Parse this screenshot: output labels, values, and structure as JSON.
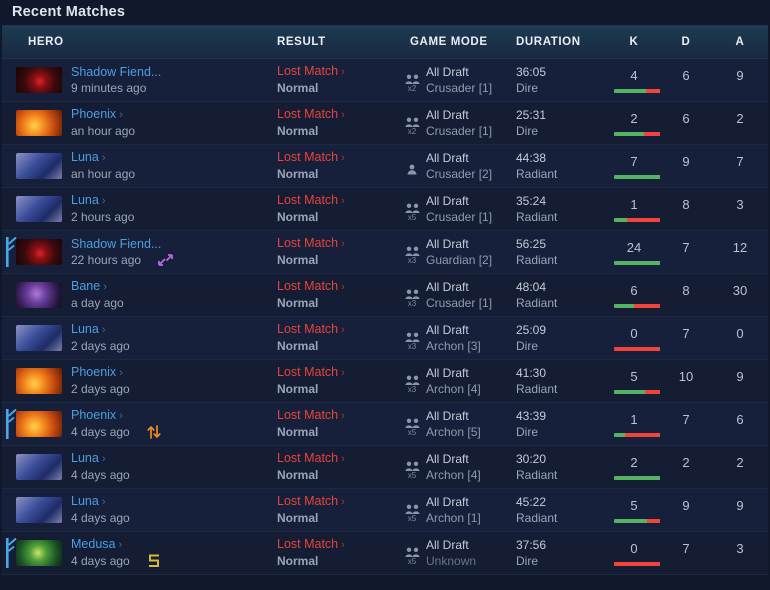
{
  "header": {
    "title": "Recent Matches"
  },
  "columns": {
    "hero": "HERO",
    "result": "RESULT",
    "game_mode": "GAME MODE",
    "duration": "DURATION",
    "k": "K",
    "d": "D",
    "a": "A"
  },
  "colors": {
    "hero_link": "#4b9fe3",
    "lost": "#e8443b",
    "kills_bar": "#55b363",
    "deaths_bar": "#f2443c",
    "assists_bar": "#8aa3b8",
    "row_flag": "#4aa8e8",
    "badge_purple": "#b968e0",
    "badge_orange": "#f08a20",
    "badge_gold": "#d9b93c"
  },
  "rows": [
    {
      "hero": "Shadow Fiend...",
      "hero_art": "p-shadowfiend",
      "chevron": false,
      "time": "9 minutes ago",
      "badge": null,
      "flag": false,
      "result": "Lost Match",
      "result_sub": "Normal",
      "mode": "All Draft",
      "rank": "Crusader [1]",
      "rank_unknown": false,
      "party": "x2",
      "party_n": 2,
      "duration": "36:05",
      "side": "Dire",
      "k": 4,
      "d": 6,
      "a": 9
    },
    {
      "hero": "Phoenix",
      "hero_art": "p-phoenix",
      "chevron": true,
      "time": "an hour ago",
      "badge": null,
      "flag": false,
      "result": "Lost Match",
      "result_sub": "Normal",
      "mode": "All Draft",
      "rank": "Crusader [1]",
      "rank_unknown": false,
      "party": "x2",
      "party_n": 2,
      "duration": "25:31",
      "side": "Dire",
      "k": 2,
      "d": 6,
      "a": 2
    },
    {
      "hero": "Luna",
      "hero_art": "p-luna",
      "chevron": true,
      "time": "an hour ago",
      "badge": null,
      "flag": false,
      "result": "Lost Match",
      "result_sub": "Normal",
      "mode": "All Draft",
      "rank": "Crusader [2]",
      "rank_unknown": false,
      "party": "",
      "party_n": 1,
      "duration": "44:38",
      "side": "Radiant",
      "k": 7,
      "d": 9,
      "a": 7
    },
    {
      "hero": "Luna",
      "hero_art": "p-luna",
      "chevron": true,
      "time": "2 hours ago",
      "badge": null,
      "flag": false,
      "result": "Lost Match",
      "result_sub": "Normal",
      "mode": "All Draft",
      "rank": "Crusader [1]",
      "rank_unknown": false,
      "party": "x5",
      "party_n": 5,
      "duration": "35:24",
      "side": "Radiant",
      "k": 1,
      "d": 8,
      "a": 3
    },
    {
      "hero": "Shadow Fiend...",
      "hero_art": "p-shadowfiend",
      "chevron": false,
      "time": "22 hours ago",
      "badge": "double-arrow-icon",
      "flag": true,
      "result": "Lost Match",
      "result_sub": "Normal",
      "mode": "All Draft",
      "rank": "Guardian [2]",
      "rank_unknown": false,
      "party": "x3",
      "party_n": 3,
      "duration": "56:25",
      "side": "Radiant",
      "k": 24,
      "d": 7,
      "a": 12
    },
    {
      "hero": "Bane",
      "hero_art": "p-bane",
      "chevron": true,
      "time": "a day ago",
      "badge": null,
      "flag": false,
      "result": "Lost Match",
      "result_sub": "Normal",
      "mode": "All Draft",
      "rank": "Crusader [1]",
      "rank_unknown": false,
      "party": "x3",
      "party_n": 3,
      "duration": "48:04",
      "side": "Radiant",
      "k": 6,
      "d": 8,
      "a": 30
    },
    {
      "hero": "Luna",
      "hero_art": "p-luna",
      "chevron": true,
      "time": "2 days ago",
      "badge": null,
      "flag": false,
      "result": "Lost Match",
      "result_sub": "Normal",
      "mode": "All Draft",
      "rank": "Archon [3]",
      "rank_unknown": false,
      "party": "x3",
      "party_n": 3,
      "duration": "25:09",
      "side": "Dire",
      "k": 0,
      "d": 7,
      "a": 0
    },
    {
      "hero": "Phoenix",
      "hero_art": "p-phoenix",
      "chevron": true,
      "time": "2 days ago",
      "badge": null,
      "flag": false,
      "result": "Lost Match",
      "result_sub": "Normal",
      "mode": "All Draft",
      "rank": "Archon [4]",
      "rank_unknown": false,
      "party": "x3",
      "party_n": 3,
      "duration": "41:30",
      "side": "Radiant",
      "k": 5,
      "d": 10,
      "a": 9
    },
    {
      "hero": "Phoenix",
      "hero_art": "p-phoenix",
      "chevron": true,
      "time": "4 days ago",
      "badge": "swap-arrows-icon",
      "flag": true,
      "result": "Lost Match",
      "result_sub": "Normal",
      "mode": "All Draft",
      "rank": "Archon [5]",
      "rank_unknown": false,
      "party": "x5",
      "party_n": 5,
      "duration": "43:39",
      "side": "Dire",
      "k": 1,
      "d": 7,
      "a": 6
    },
    {
      "hero": "Luna",
      "hero_art": "p-luna",
      "chevron": true,
      "time": "4 days ago",
      "badge": null,
      "flag": false,
      "result": "Lost Match",
      "result_sub": "Normal",
      "mode": "All Draft",
      "rank": "Archon [4]",
      "rank_unknown": false,
      "party": "x5",
      "party_n": 5,
      "duration": "30:20",
      "side": "Radiant",
      "k": 2,
      "d": 2,
      "a": 2
    },
    {
      "hero": "Luna",
      "hero_art": "p-luna",
      "chevron": true,
      "time": "4 days ago",
      "badge": null,
      "flag": false,
      "result": "Lost Match",
      "result_sub": "Normal",
      "mode": "All Draft",
      "rank": "Archon [1]",
      "rank_unknown": false,
      "party": "x5",
      "party_n": 5,
      "duration": "45:22",
      "side": "Radiant",
      "k": 5,
      "d": 9,
      "a": 9
    },
    {
      "hero": "Medusa",
      "hero_art": "p-medusa",
      "chevron": true,
      "time": "4 days ago",
      "badge": "rematch-icon",
      "flag": true,
      "result": "Lost Match",
      "result_sub": "Normal",
      "mode": "All Draft",
      "rank": "Unknown",
      "rank_unknown": true,
      "party": "x5",
      "party_n": 5,
      "duration": "37:56",
      "side": "Dire",
      "k": 0,
      "d": 7,
      "a": 3
    }
  ]
}
